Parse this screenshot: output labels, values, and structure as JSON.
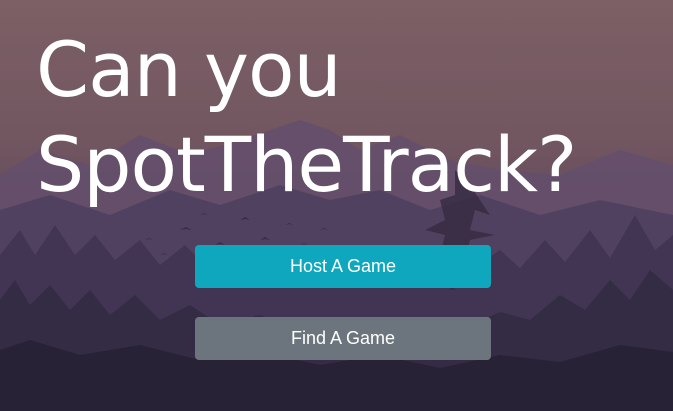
{
  "hero": {
    "title_line1": "Can you",
    "title_line2": "SpotTheTrack?"
  },
  "actions": {
    "host_label": "Host A Game",
    "find_label": "Find A Game"
  },
  "colors": {
    "host_button": "#17a2b8",
    "find_button": "#6c757d",
    "title_text": "#ffffff"
  }
}
